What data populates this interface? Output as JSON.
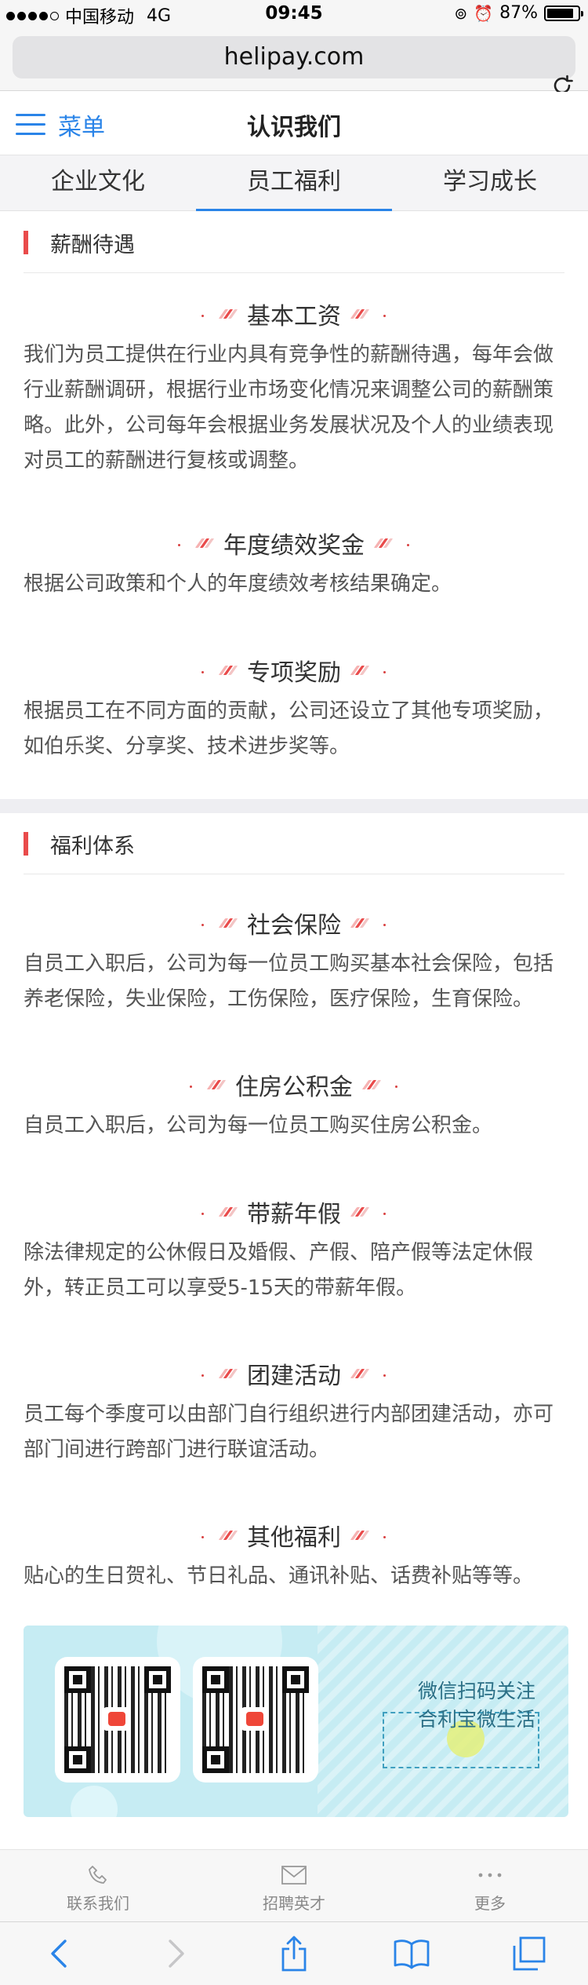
{
  "status_bar": {
    "carrier": "中国移动",
    "network": "4G",
    "time": "09:45",
    "battery_percent": "87%",
    "battery_level": 0.87
  },
  "browser": {
    "url": "helipay.com"
  },
  "header": {
    "menu_label": "菜单",
    "title": "认识我们"
  },
  "tabs": [
    {
      "label": "企业文化",
      "active": false
    },
    {
      "label": "员工福利",
      "active": true
    },
    {
      "label": "学习成长",
      "active": false
    }
  ],
  "salary": {
    "heading": "薪酬待遇",
    "items": [
      {
        "title": "基本工资",
        "text": "我们为员工提供在行业内具有竞争性的薪酬待遇，每年会做行业薪酬调研，根据行业市场变化情况来调整公司的薪酬策略。此外，公司每年会根据业务发展状况及个人的业绩表现对员工的薪酬进行复核或调整。"
      },
      {
        "title": "年度绩效奖金",
        "text": "根据公司政策和个人的年度绩效考核结果确定。"
      },
      {
        "title": "专项奖励",
        "text": "根据员工在不同方面的贡献，公司还设立了其他专项奖励，如伯乐奖、分享奖、技术进步奖等。"
      }
    ]
  },
  "benefits": {
    "heading": "福利体系",
    "items": [
      {
        "title": "社会保险",
        "text": "自员工入职后，公司为每一位员工购买基本社会保险，包括养老保险，失业保险，工伤保险，医疗保险，生育保险。"
      },
      {
        "title": "住房公积金",
        "text": "自员工入职后，公司为每一位员工购买住房公积金。"
      },
      {
        "title": "带薪年假",
        "text": "除法律规定的公休假日及婚假、产假、陪产假等法定休假外，转正员工可以享受5-15天的带薪年假。"
      },
      {
        "title": "团建活动",
        "text": "员工每个季度可以由部门自行组织进行内部团建活动，亦可部门间进行跨部门进行联谊活动。"
      },
      {
        "title": "其他福利",
        "text": "贴心的生日贺礼、节日礼品、通讯补贴、话费补贴等等。"
      }
    ]
  },
  "banner": {
    "line1": "微信扫码关注",
    "line2": "合利宝微生活"
  },
  "page_nav": [
    {
      "label": "联系我们",
      "icon": "phone-icon"
    },
    {
      "label": "招聘英才",
      "icon": "mail-icon"
    },
    {
      "label": "更多",
      "icon": "more-icon"
    }
  ],
  "colors": {
    "accent": "#2a84e8",
    "section_marker": "#e94b4b",
    "banner_bg": "#c6ecf3"
  }
}
